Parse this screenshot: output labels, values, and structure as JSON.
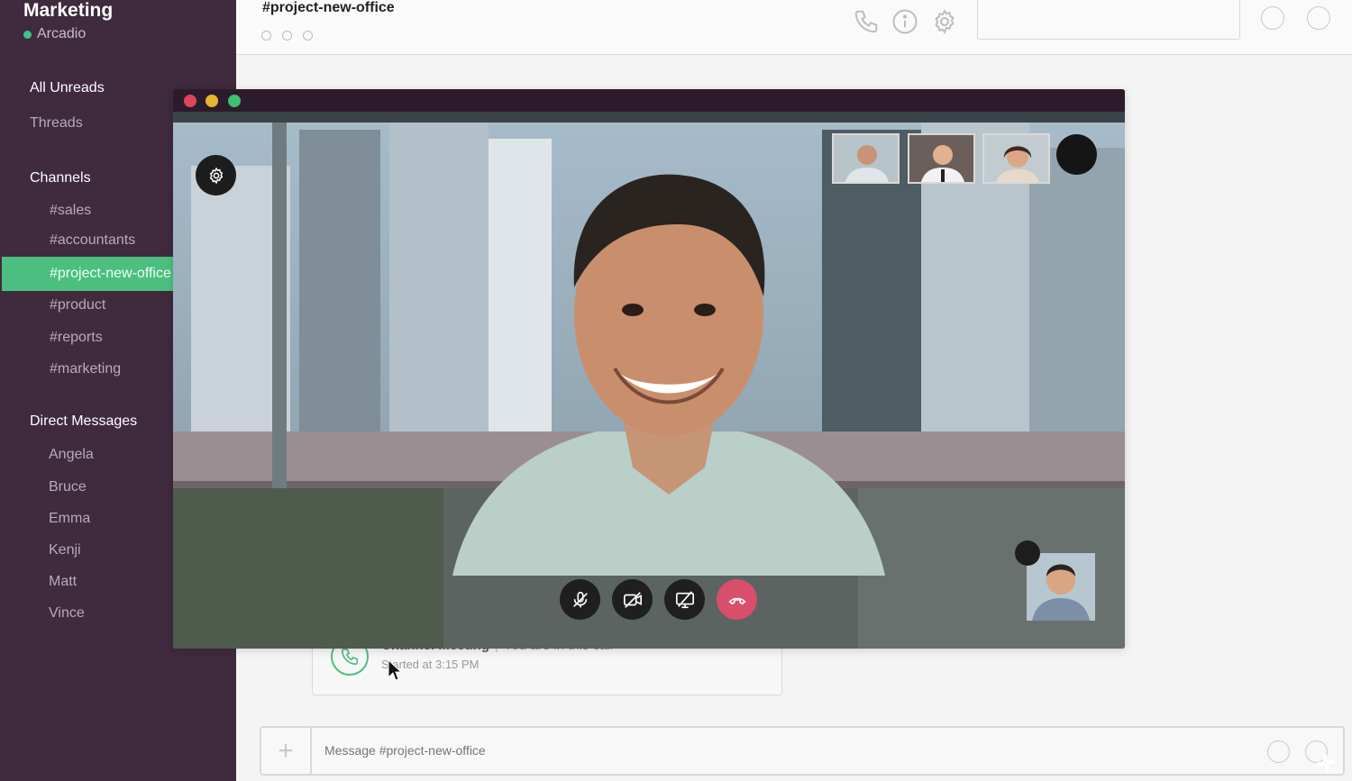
{
  "workspace": {
    "name": "Marketing",
    "user": "Arcadio",
    "status_color": "#3ec28f"
  },
  "nav": {
    "all_unreads": "All Unreads",
    "threads": "Threads"
  },
  "channels": {
    "title": "Channels",
    "items": [
      "#sales",
      "#accountants",
      "#project-new-office",
      "#product",
      "#reports",
      "#marketing"
    ],
    "active": "#project-new-office"
  },
  "direct_messages": {
    "title": "Direct Messages",
    "items": [
      "Angela",
      "Bruce",
      "Emma",
      "Kenji",
      "Matt",
      "Vince"
    ]
  },
  "header": {
    "channel_title": "#project-new-office"
  },
  "call_card": {
    "title": "Channel Meeting",
    "status": "You are in this call",
    "started": "Started at 3:15 PM"
  },
  "composer": {
    "placeholder": "Message #project-new-office"
  },
  "colors": {
    "sidebar_bg": "#3f2a3e",
    "active_channel": "#4cbf80",
    "hangup": "#d94e6a",
    "traffic_red": "#e0445c",
    "traffic_yellow": "#e6b52c",
    "traffic_green": "#3fbf6f"
  },
  "icons": {
    "header": [
      "phone-icon",
      "info-icon",
      "gear-icon"
    ],
    "call_controls": [
      "mic-off-icon",
      "video-off-icon",
      "screen-share-off-icon",
      "hang-up-icon"
    ]
  }
}
